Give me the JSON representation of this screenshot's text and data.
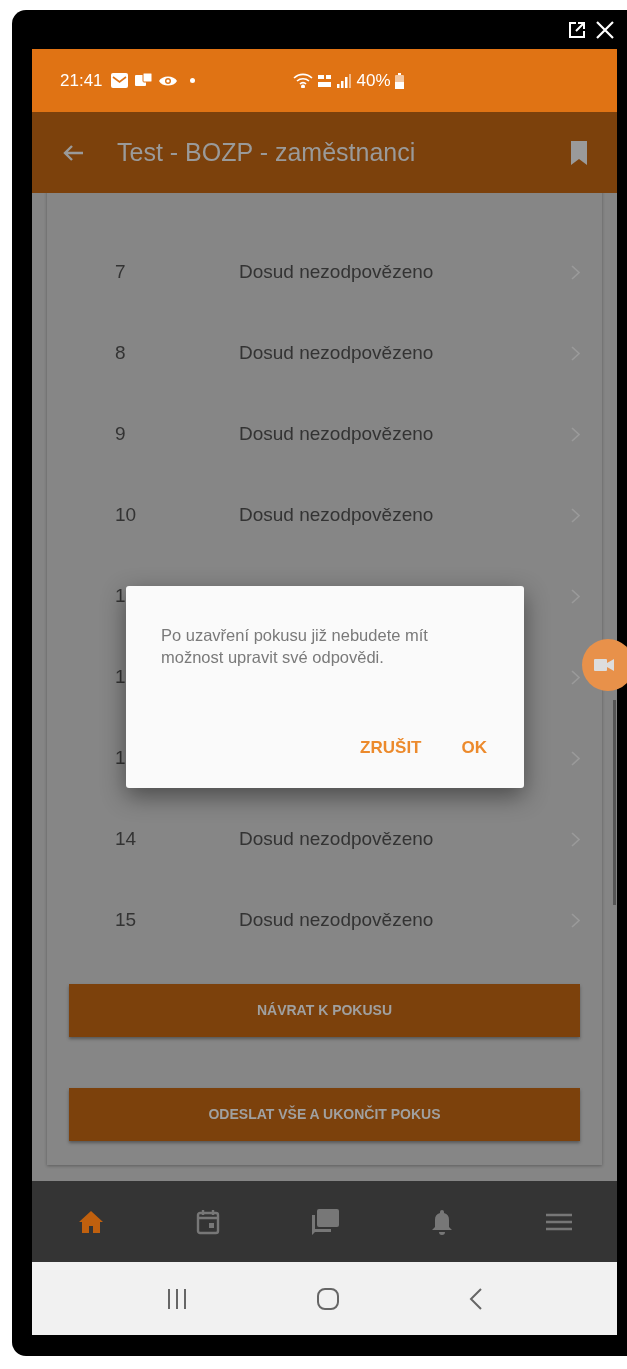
{
  "status_bar": {
    "time": "21:41",
    "battery": "40%"
  },
  "app_bar": {
    "title": "Test - BOZP - zaměstnanci"
  },
  "questions": [
    {
      "number": "7",
      "status": "Dosud nezodpovězeno"
    },
    {
      "number": "8",
      "status": "Dosud nezodpovězeno"
    },
    {
      "number": "9",
      "status": "Dosud nezodpovězeno"
    },
    {
      "number": "10",
      "status": "Dosud nezodpovězeno"
    },
    {
      "number": "1"
    },
    {
      "number": "1"
    },
    {
      "number": "1"
    },
    {
      "number": "14",
      "status": "Dosud nezodpovězeno"
    },
    {
      "number": "15",
      "status": "Dosud nezodpovězeno"
    }
  ],
  "actions": [
    "NÁVRAT K POKUSU",
    "ODESLAT VŠE A UKONČIT POKUS"
  ],
  "dialog": {
    "message": "Po uzavření pokusu již nebudete mít možnost upravit své odpovědi.",
    "buttons": [
      "ZRUŠIT",
      "OK"
    ]
  },
  "bottom_nav": [
    {
      "kind": "home",
      "selected": true
    },
    {
      "kind": "calendar",
      "selected": false
    },
    {
      "kind": "chat",
      "selected": false
    },
    {
      "kind": "bell",
      "selected": false
    },
    {
      "kind": "menu",
      "selected": false
    }
  ]
}
